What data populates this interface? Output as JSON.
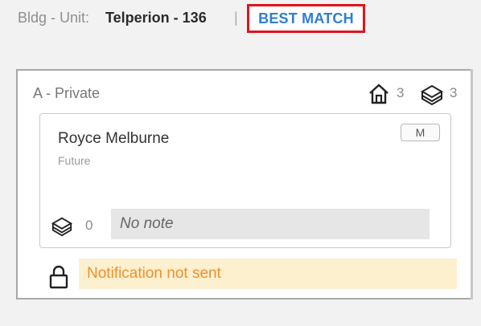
{
  "header": {
    "bldg_prefix": "Bldg - Unit:",
    "bldg_value": "Telperion - 136",
    "separator": "|",
    "best_match_label": "BEST MATCH"
  },
  "card": {
    "title": "A - Private",
    "home_count": "3",
    "docs_count": "3",
    "icons": [
      "home-icon",
      "documents-icon"
    ]
  },
  "resident": {
    "name": "Royce Melburne",
    "status": "Future",
    "badge": "M",
    "note_count": "0",
    "note_text": "No note"
  },
  "notification": {
    "text": "Notification not sent",
    "icon": "lock-icon"
  },
  "colors": {
    "accent_blue": "#2e7fd1",
    "highlight_red": "#e3121d",
    "warning_text": "#f0902c",
    "warning_bg": "#fdf0cf"
  }
}
